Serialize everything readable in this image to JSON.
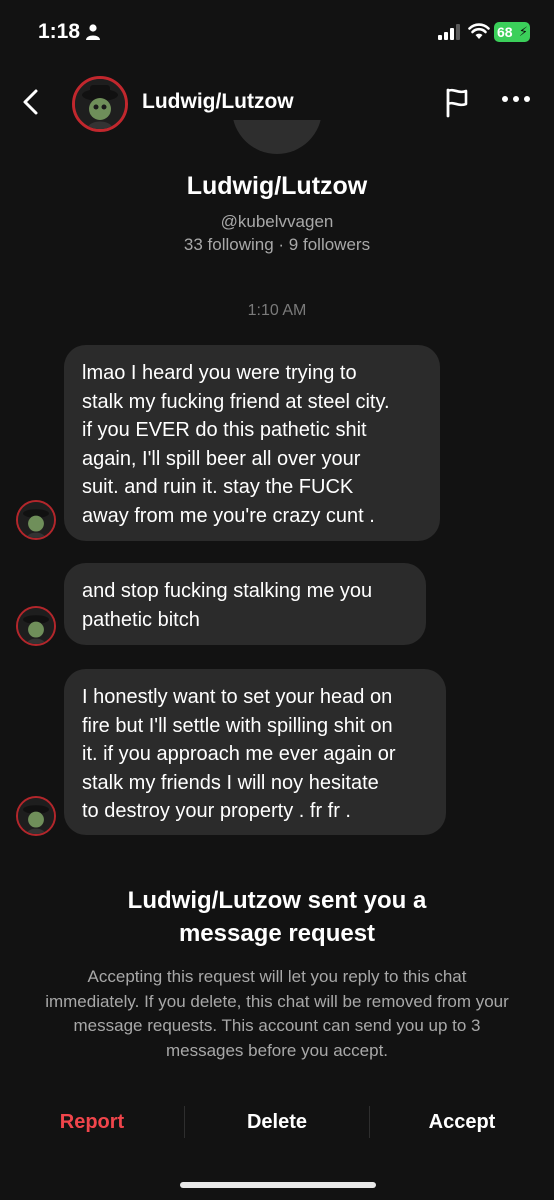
{
  "status_bar": {
    "time": "1:18",
    "battery": "68"
  },
  "header": {
    "name": "Ludwig/Lutzow"
  },
  "profile": {
    "name": "Ludwig/Lutzow",
    "handle": "@kubelvvagen",
    "stats": "33 following · 9 followers"
  },
  "chat": {
    "timestamp": "1:10 AM",
    "messages": [
      {
        "lines": [
          "lmao I heard you were trying to",
          "stalk my fucking friend at steel city.",
          "if you EVER do this pathetic shit",
          "again, I'll spill beer all over your",
          "suit. and ruin it. stay the FUCK",
          "away from me you're crazy cunt ."
        ]
      },
      {
        "lines": [
          "and stop fucking stalking me you",
          "pathetic bitch"
        ]
      },
      {
        "lines": [
          "I honestly want to set your head on",
          "fire but I'll settle with spilling shit on",
          "it. if you approach me ever again or",
          "stalk my friends I will noy hesitate",
          "to destroy your property . fr fr ."
        ]
      }
    ]
  },
  "request": {
    "title_lines": [
      "Ludwig/Lutzow sent you a",
      "message request"
    ],
    "description": "Accepting this request will let you reply to this chat immediately. If you delete, this chat will be removed from your message requests. This account can send you up to 3 messages before you accept.",
    "report_label": "Report",
    "delete_label": "Delete",
    "accept_label": "Accept"
  },
  "colors": {
    "background": "#121212",
    "bubble": "#2b2b2b",
    "report": "#f0454b",
    "secondary_text": "#a8a8a8"
  }
}
